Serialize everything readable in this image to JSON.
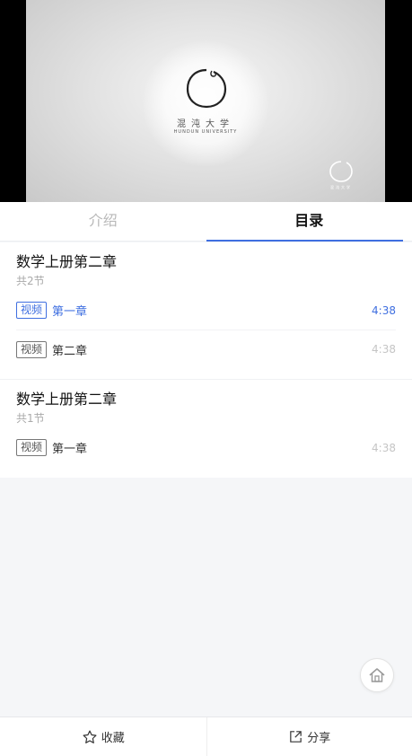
{
  "video": {
    "logo_text": "混沌大学",
    "logo_subtext": "HUNDUN UNIVERSITY",
    "watermark_text": "混沌大学"
  },
  "tabs": {
    "intro": "介绍",
    "catalog": "目录",
    "active": "catalog"
  },
  "sections": [
    {
      "title": "数学上册第二章",
      "count": "共2节",
      "lessons": [
        {
          "tag": "视频",
          "name": "第一章",
          "duration": "4:38",
          "active": true
        },
        {
          "tag": "视频",
          "name": "第二章",
          "duration": "4:38",
          "active": false
        }
      ]
    },
    {
      "title": "数学上册第二章",
      "count": "共1节",
      "lessons": [
        {
          "tag": "视频",
          "name": "第一章",
          "duration": "4:38",
          "active": false
        }
      ]
    }
  ],
  "bottom_bar": {
    "favorite_label": "收藏",
    "share_label": "分享"
  },
  "icons": {
    "home": "home-icon",
    "favorite": "star-icon",
    "share": "share-icon"
  },
  "colors": {
    "accent": "#3f6fe0",
    "muted": "#aaaaaa",
    "background": "#f5f6f8"
  }
}
